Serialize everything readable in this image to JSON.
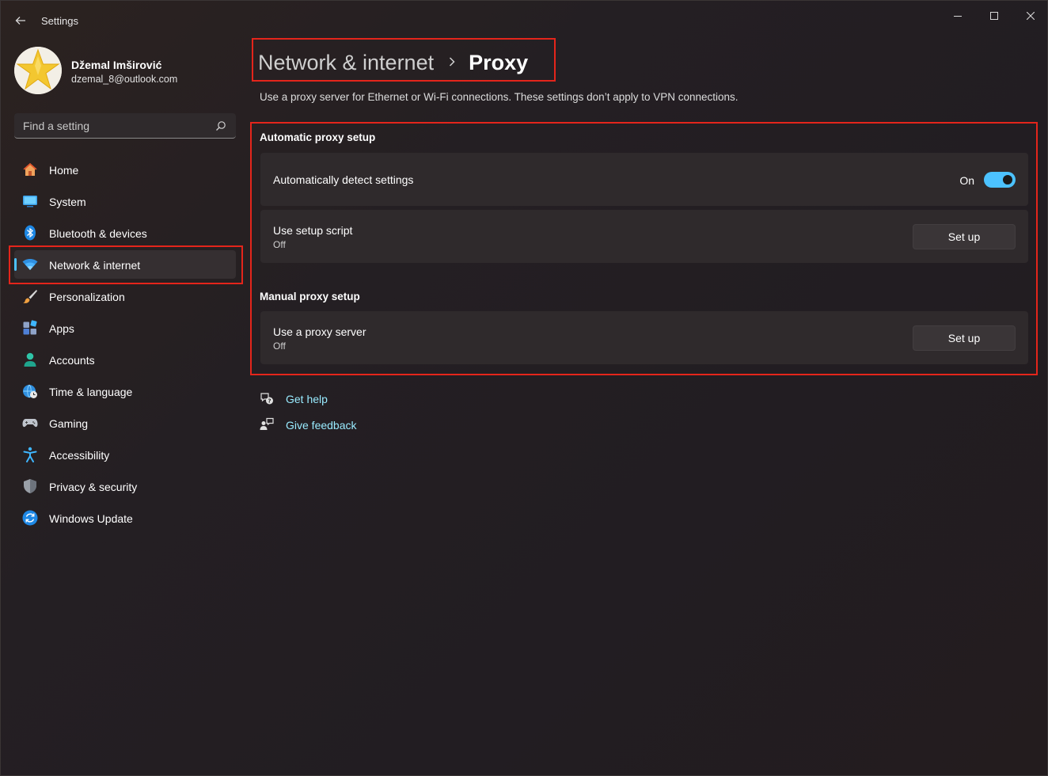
{
  "titlebar": {
    "app_title": "Settings",
    "back_icon": "back-arrow-icon",
    "minimize_icon": "minimize-icon",
    "maximize_icon": "maximize-icon",
    "close_icon": "close-icon"
  },
  "profile": {
    "name": "Džemal Imširović",
    "email": "dzemal_8@outlook.com",
    "avatar_icon": "star-avatar-icon"
  },
  "search": {
    "placeholder": "Find a setting",
    "icon": "search-icon"
  },
  "sidebar": {
    "items": [
      {
        "label": "Home",
        "icon": "home-icon"
      },
      {
        "label": "System",
        "icon": "system-icon"
      },
      {
        "label": "Bluetooth & devices",
        "icon": "bluetooth-icon"
      },
      {
        "label": "Network & internet",
        "icon": "wifi-icon",
        "selected": true
      },
      {
        "label": "Personalization",
        "icon": "brush-icon"
      },
      {
        "label": "Apps",
        "icon": "apps-icon"
      },
      {
        "label": "Accounts",
        "icon": "person-icon"
      },
      {
        "label": "Time & language",
        "icon": "globe-clock-icon"
      },
      {
        "label": "Gaming",
        "icon": "gamepad-icon"
      },
      {
        "label": "Accessibility",
        "icon": "accessibility-icon"
      },
      {
        "label": "Privacy & security",
        "icon": "shield-icon"
      },
      {
        "label": "Windows Update",
        "icon": "update-icon"
      }
    ]
  },
  "main": {
    "breadcrumb_parent": "Network & internet",
    "breadcrumb_current": "Proxy",
    "description": "Use a proxy server for Ethernet or Wi-Fi connections. These settings don’t apply to VPN connections.",
    "automatic": {
      "title": "Automatic proxy setup",
      "detect": {
        "label": "Automatically detect settings",
        "state": "On",
        "enabled": true
      },
      "script": {
        "label": "Use setup script",
        "status": "Off",
        "button": "Set up"
      }
    },
    "manual": {
      "title": "Manual proxy setup",
      "proxy": {
        "label": "Use a proxy server",
        "status": "Off",
        "button": "Set up"
      }
    },
    "links": {
      "help": "Get help",
      "feedback": "Give feedback"
    }
  },
  "colors": {
    "accent": "#4cc2ff",
    "highlight": "#e4251b",
    "link": "#99ebff"
  }
}
